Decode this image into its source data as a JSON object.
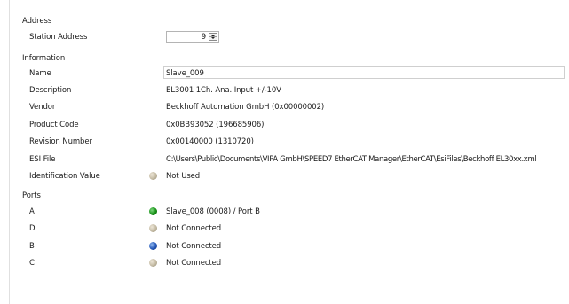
{
  "sections": {
    "address": "Address",
    "information": "Information",
    "ports": "Ports"
  },
  "address": {
    "station_address_label": "Station Address",
    "station_address_value": "9"
  },
  "information": {
    "rows": [
      {
        "label": "Name",
        "value": "Slave_009"
      },
      {
        "label": "Description",
        "value": "EL3001 1Ch. Ana. Input +/-10V"
      },
      {
        "label": "Vendor",
        "value": "Beckhoff Automation GmbH (0x00000002)"
      },
      {
        "label": "Product Code",
        "value": "0x0BB93052 (196685906)"
      },
      {
        "label": "Revision Number",
        "value": "0x00140000 (1310720)"
      },
      {
        "label": "ESI File",
        "value": "C:\\Users\\Public\\Documents\\VIPA GmbH\\SPEED7 EtherCAT Manager\\EtherCAT\\EsiFiles\\Beckhoff EL30xx.xml"
      },
      {
        "label": "Identification Value",
        "value": "Not Used",
        "status_color": "#c8bfa9"
      }
    ]
  },
  "ports": [
    {
      "label": "A",
      "value": "Slave_008 (0008) / Port B",
      "status_color": "#179017"
    },
    {
      "label": "D",
      "value": "Not Connected",
      "status_color": "#c8bfa9"
    },
    {
      "label": "B",
      "value": "Not Connected",
      "status_color": "#2658b8"
    },
    {
      "label": "C",
      "value": "Not Connected",
      "status_color": "#c8bfa9"
    }
  ],
  "icons": {
    "status_dot": "circle-status-icon",
    "spinner_up": "chevron-up-icon",
    "spinner_down": "chevron-down-icon"
  }
}
